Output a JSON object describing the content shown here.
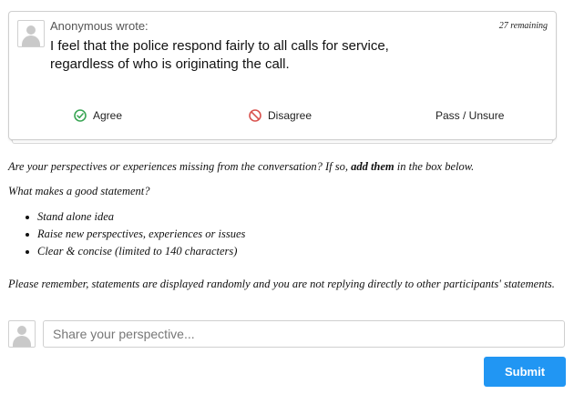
{
  "card": {
    "author": "Anonymous wrote:",
    "remaining": "27 remaining",
    "statement": "I feel that the police respond fairly to all calls for service, regardless of who is originating the call.",
    "votes": {
      "agree": {
        "label": "Agree",
        "icon": "check-circle-icon",
        "color": "#3aa655"
      },
      "disagree": {
        "label": "Disagree",
        "icon": "ban-icon",
        "color": "#d9534f"
      },
      "pass": {
        "label": "Pass / Unsure"
      }
    }
  },
  "instructions": {
    "missing_pre": "Are your perspectives or experiences missing from the conversation? If so, ",
    "missing_bold": "add them",
    "missing_post": " in the box below.",
    "good_heading": "What makes a good statement?",
    "tips": [
      "Stand alone idea",
      "Raise new perspectives, experiences or issues",
      "Clear & concise (limited to 140 characters)"
    ],
    "remember": "Please remember, statements are displayed randomly and you are not replying directly to other participants' statements."
  },
  "compose": {
    "placeholder": "Share your perspective...",
    "submit_label": "Submit",
    "submit_color": "#2196f3"
  }
}
